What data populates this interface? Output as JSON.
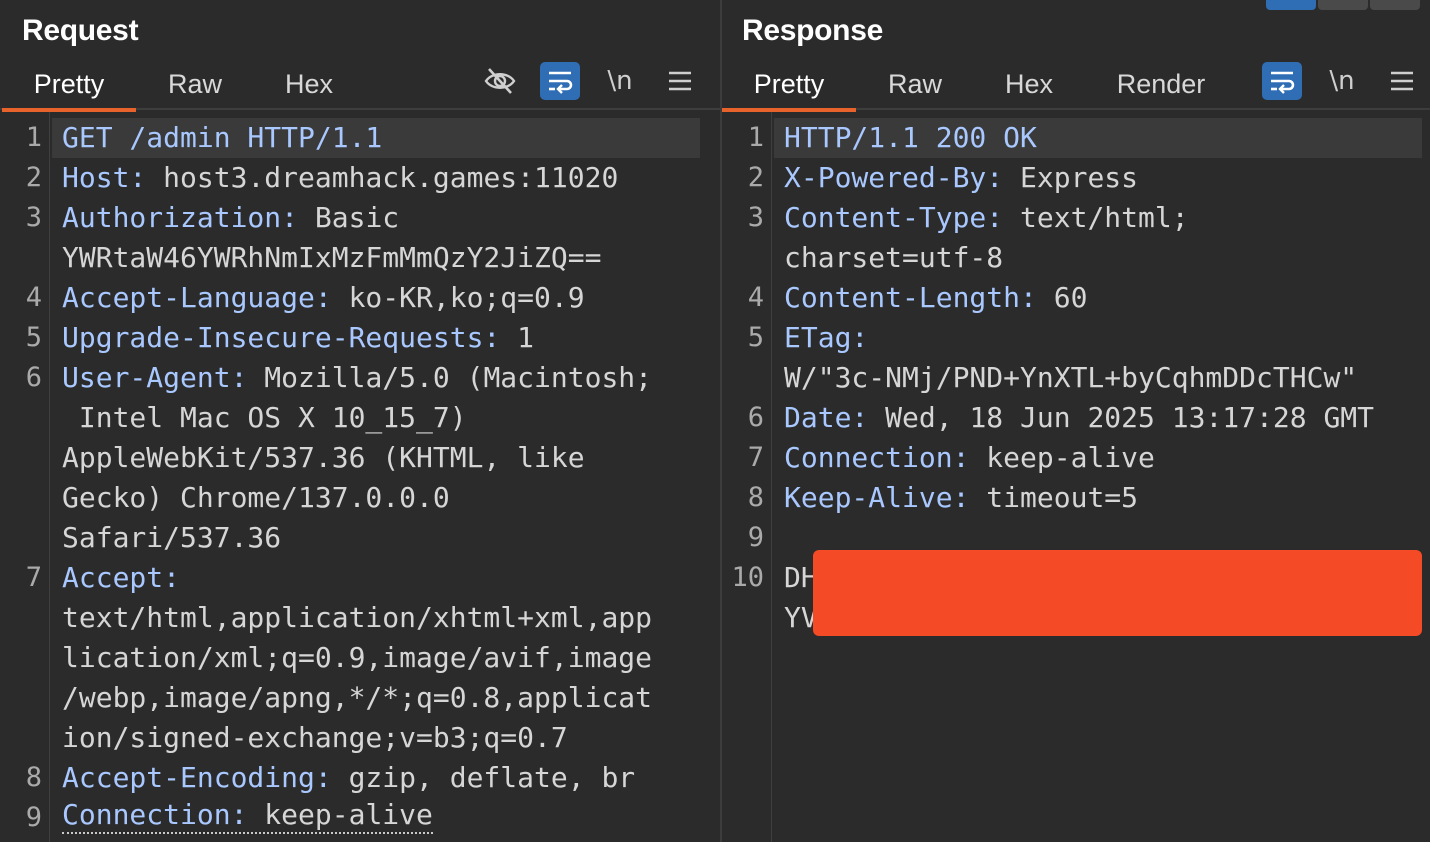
{
  "request": {
    "title": "Request",
    "tabs": [
      "Pretty",
      "Raw",
      "Hex"
    ],
    "newline_label": "\\n",
    "gutter": [
      {
        "n": "1",
        "row": 0
      },
      {
        "n": "2",
        "row": 1
      },
      {
        "n": "3",
        "row": 2
      },
      {
        "n": "4",
        "row": 4
      },
      {
        "n": "5",
        "row": 5
      },
      {
        "n": "6",
        "row": 6
      },
      {
        "n": "7",
        "row": 11
      },
      {
        "n": "8",
        "row": 16
      },
      {
        "n": "9",
        "row": 17
      }
    ],
    "lines": [
      {
        "key": "GET /admin HTTP/1.1",
        "val": ""
      },
      {
        "key": "Host:",
        "val": " host3.dreamhack.games:11020"
      },
      {
        "key": "Authorization:",
        "val": " Basic"
      },
      {
        "key": "",
        "val": "YWRtaW46YWRhNmIxMzFmMmQzY2JiZQ=="
      },
      {
        "key": "Accept-Language:",
        "val": " ko-KR,ko;q=0.9"
      },
      {
        "key": "Upgrade-Insecure-Requests:",
        "val": " 1"
      },
      {
        "key": "User-Agent:",
        "val": " Mozilla/5.0 (Macintosh;"
      },
      {
        "key": "",
        "val": " Intel Mac OS X 10_15_7)"
      },
      {
        "key": "",
        "val": "AppleWebKit/537.36 (KHTML, like"
      },
      {
        "key": "",
        "val": "Gecko) Chrome/137.0.0.0"
      },
      {
        "key": "",
        "val": "Safari/537.36"
      },
      {
        "key": "Accept:",
        "val": ""
      },
      {
        "key": "",
        "val": "text/html,application/xhtml+xml,app"
      },
      {
        "key": "",
        "val": "lication/xml;q=0.9,image/avif,image"
      },
      {
        "key": "",
        "val": "/webp,image/apng,*/*;q=0.8,applicat"
      },
      {
        "key": "",
        "val": "ion/signed-exchange;v=b3;q=0.7"
      },
      {
        "key": "Accept-Encoding:",
        "val": " gzip, deflate, br"
      },
      {
        "key": "Connection:",
        "val": " keep-alive"
      }
    ]
  },
  "response": {
    "title": "Response",
    "tabs": [
      "Pretty",
      "Raw",
      "Hex",
      "Render"
    ],
    "newline_label": "\\n",
    "gutter": [
      {
        "n": "1",
        "row": 0
      },
      {
        "n": "2",
        "row": 1
      },
      {
        "n": "3",
        "row": 2
      },
      {
        "n": "4",
        "row": 4
      },
      {
        "n": "5",
        "row": 5
      },
      {
        "n": "6",
        "row": 7
      },
      {
        "n": "7",
        "row": 8
      },
      {
        "n": "8",
        "row": 9
      },
      {
        "n": "9",
        "row": 10
      },
      {
        "n": "10",
        "row": 11
      }
    ],
    "lines": [
      {
        "key": "HTTP/1.1 200 OK",
        "val": ""
      },
      {
        "key": "X-Powered-By:",
        "val": " Express"
      },
      {
        "key": "Content-Type:",
        "val": " text/html;"
      },
      {
        "key": "",
        "val": "charset=utf-8"
      },
      {
        "key": "Content-Length:",
        "val": " 60"
      },
      {
        "key": "ETag:",
        "val": ""
      },
      {
        "key": "",
        "val": "W/\"3c-NMj/PND+YnXTL+byCqhmDDcTHCw\""
      },
      {
        "key": "Date:",
        "val": " Wed, 18 Jun 2025 13:17:28 GMT"
      },
      {
        "key": "Connection:",
        "val": " keep-alive"
      },
      {
        "key": "Keep-Alive:",
        "val": " timeout=5"
      },
      {
        "key": "",
        "val": ""
      },
      {
        "key": "",
        "val": "DH"
      },
      {
        "key": "",
        "val": "YV"
      }
    ]
  },
  "colors": {
    "background": "#2b2b2b",
    "header_key": "#a9c8ff",
    "active_tab_underline": "#e8622c",
    "toggle_on": "#2f6db5",
    "redaction": "#f44a25"
  }
}
